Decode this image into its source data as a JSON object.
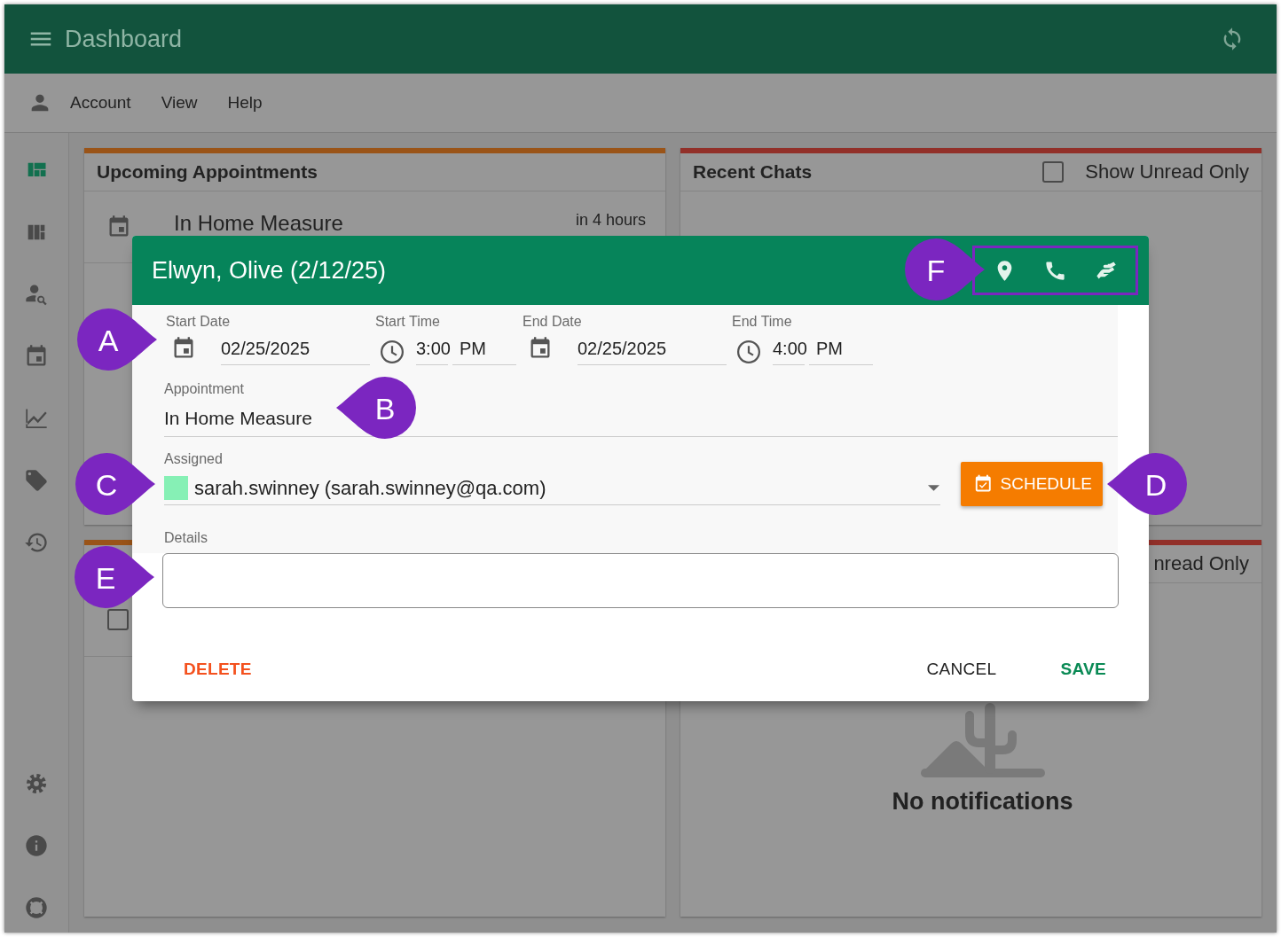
{
  "top_bar": {
    "title": "Dashboard"
  },
  "menu": [
    "Account",
    "View",
    "Help"
  ],
  "sidebar": {
    "items": [
      {
        "selected": true
      },
      {
        "selected": false
      },
      {
        "selected": false
      },
      {
        "selected": false
      },
      {
        "selected": false
      },
      {
        "selected": false
      },
      {
        "selected": false
      }
    ]
  },
  "cards": [
    {
      "title": "Upcoming Appointments",
      "color": "#9a5418",
      "appointments": [
        {
          "title": "In Home Measure",
          "time": "in 4 hours"
        }
      ]
    },
    {
      "title": "Recent Chats",
      "color": "#923029",
      "filter": {
        "label": "Show Unread Only",
        "checked": false
      }
    },
    {
      "color": "#9a5418",
      "rows": [
        {
          "checked": false
        }
      ]
    },
    {
      "color": "#923029",
      "filter": {
        "label": "nread Only"
      },
      "empty_message": "No notifications"
    }
  ],
  "dialog": {
    "title": "Elwyn, Olive (2/12/25)",
    "header_actions_highlighted": true,
    "schedule": [
      {
        "kind": "date",
        "label": "Start Date",
        "value": "02/25/2025"
      },
      {
        "kind": "time",
        "label": "Start Time",
        "value": "3:00",
        "period": "PM"
      },
      {
        "kind": "date",
        "label": "End Date",
        "value": "02/25/2025"
      },
      {
        "kind": "time",
        "label": "End Time",
        "value": "4:00",
        "period": "PM"
      }
    ],
    "appointment": {
      "label": "Appointment",
      "value": "In Home Measure"
    },
    "assigned": {
      "label": "Assigned",
      "value": "sarah.swinney (sarah.swinney@qa.com)",
      "color": "#86f0b5"
    },
    "schedule_button": "SCHEDULE",
    "details": {
      "label": "Details"
    },
    "buttons": {
      "delete": "DELETE",
      "cancel": "CANCEL",
      "save": "SAVE"
    }
  },
  "callouts": [
    {
      "letter": "A",
      "kind": "right"
    },
    {
      "letter": "B",
      "kind": "left"
    },
    {
      "letter": "C",
      "kind": "right"
    },
    {
      "letter": "D",
      "kind": "left"
    },
    {
      "letter": "E",
      "kind": "right"
    },
    {
      "letter": "F",
      "kind": "right"
    }
  ]
}
